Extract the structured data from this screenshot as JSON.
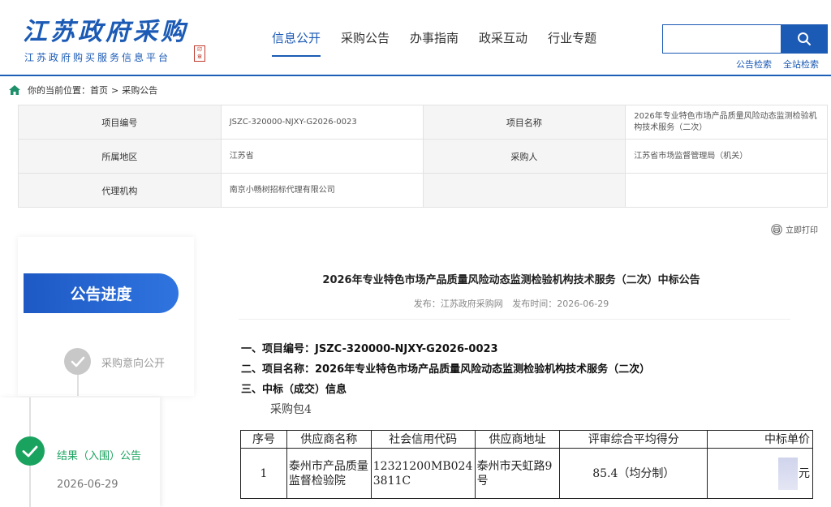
{
  "header": {
    "logo_title": "江苏政府采购",
    "logo_subtitle": "江苏政府购买服务信息平台",
    "nav": [
      "信息公开",
      "采购公告",
      "办事指南",
      "政采互动",
      "行业专题"
    ],
    "search_placeholder": "",
    "links": [
      "公告检索",
      "全站检索"
    ]
  },
  "breadcrumb": {
    "prefix": "你的当前位置：",
    "home": "首页",
    "sep": ">",
    "current": "采购公告"
  },
  "info": {
    "rows": [
      {
        "k1": "项目编号",
        "v1": "JSZC-320000-NJXY-G2026-0023",
        "k2": "项目名称",
        "v2": "2026年专业特色市场产品质量风险动态监测检验机构技术服务（二次）"
      },
      {
        "k1": "所属地区",
        "v1": "江苏省",
        "k2": "采购人",
        "v2": "江苏省市场监督管理局（机关）"
      },
      {
        "k1": "代理机构",
        "v1": "南京小畅树招标代理有限公司",
        "k2": "",
        "v2": ""
      }
    ]
  },
  "print_label": "立即打印",
  "progress": {
    "title": "公告进度",
    "step1": "采购意向公开",
    "step2": "结果（入围）公告",
    "step2_date": "2026-06-29"
  },
  "notice": {
    "title": "2026年专业特色市场产品质量风险动态监测检验机构技术服务（二次）中标公告",
    "publisher": "发布：江苏政府采购网",
    "publish_time": "发布时间：2026-06-29",
    "line1": "一、项目编号：JSZC-320000-NJXY-G2026-0023",
    "line2": "二、项目名称：2026年专业特色市场产品质量风险动态监测检验机构技术服务（二次）",
    "line3": "三、中标（成交）信息",
    "package": "采购包4"
  },
  "result_table": {
    "headers": [
      "序号",
      "供应商名称",
      "社会信用代码",
      "供应商地址",
      "评审综合平均得分",
      "中标单价"
    ],
    "row": {
      "no": "1",
      "name": "泰州市产品质量监督检验院",
      "code": "12321200MB0243811C",
      "address": "泰州市天虹路9号",
      "score": "85.4（均分制）",
      "price_unit": "元"
    }
  }
}
